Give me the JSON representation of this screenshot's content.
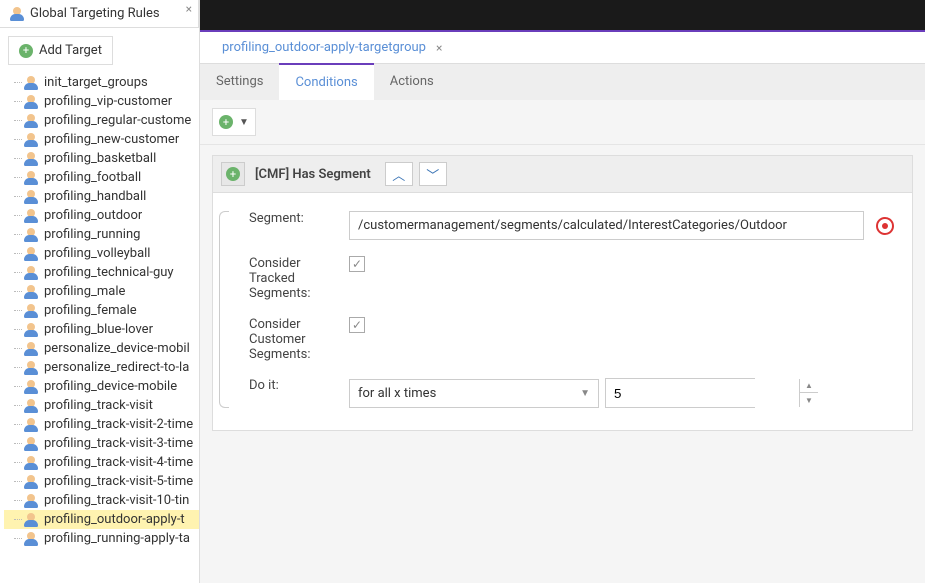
{
  "sidebar": {
    "panel_title": "Global Targeting Rules",
    "add_target_label": "Add Target",
    "items": [
      "init_target_groups",
      "profiling_vip-customer",
      "profiling_regular-custome",
      "profiling_new-customer",
      "profiling_basketball",
      "profiling_football",
      "profiling_handball",
      "profiling_outdoor",
      "profiling_running",
      "profiling_volleyball",
      "profiling_technical-guy",
      "profiling_male",
      "profiling_female",
      "profiling_blue-lover",
      "personalize_device-mobil",
      "personalize_redirect-to-la",
      "profiling_device-mobile",
      "profiling_track-visit",
      "profiling_track-visit-2-time",
      "profiling_track-visit-3-time",
      "profiling_track-visit-4-time",
      "profiling_track-visit-5-time",
      "profiling_track-visit-10-tin",
      "profiling_outdoor-apply-t",
      "profiling_running-apply-ta"
    ],
    "selected_index": 23
  },
  "editor": {
    "tab_title": "profiling_outdoor-apply-targetgroup",
    "subtabs": {
      "settings": "Settings",
      "conditions": "Conditions",
      "actions": "Actions"
    }
  },
  "condition": {
    "header": "[CMF] Has Segment",
    "segment_label": "Segment:",
    "segment_value": "/customermanagement/segments/calculated/InterestCategories/Outdoor",
    "tracked_label": "Consider Tracked Segments:",
    "customer_label": "Consider Customer Segments:",
    "doit_label": "Do it:",
    "doit_select_value": "for all x times",
    "doit_number": "5"
  }
}
